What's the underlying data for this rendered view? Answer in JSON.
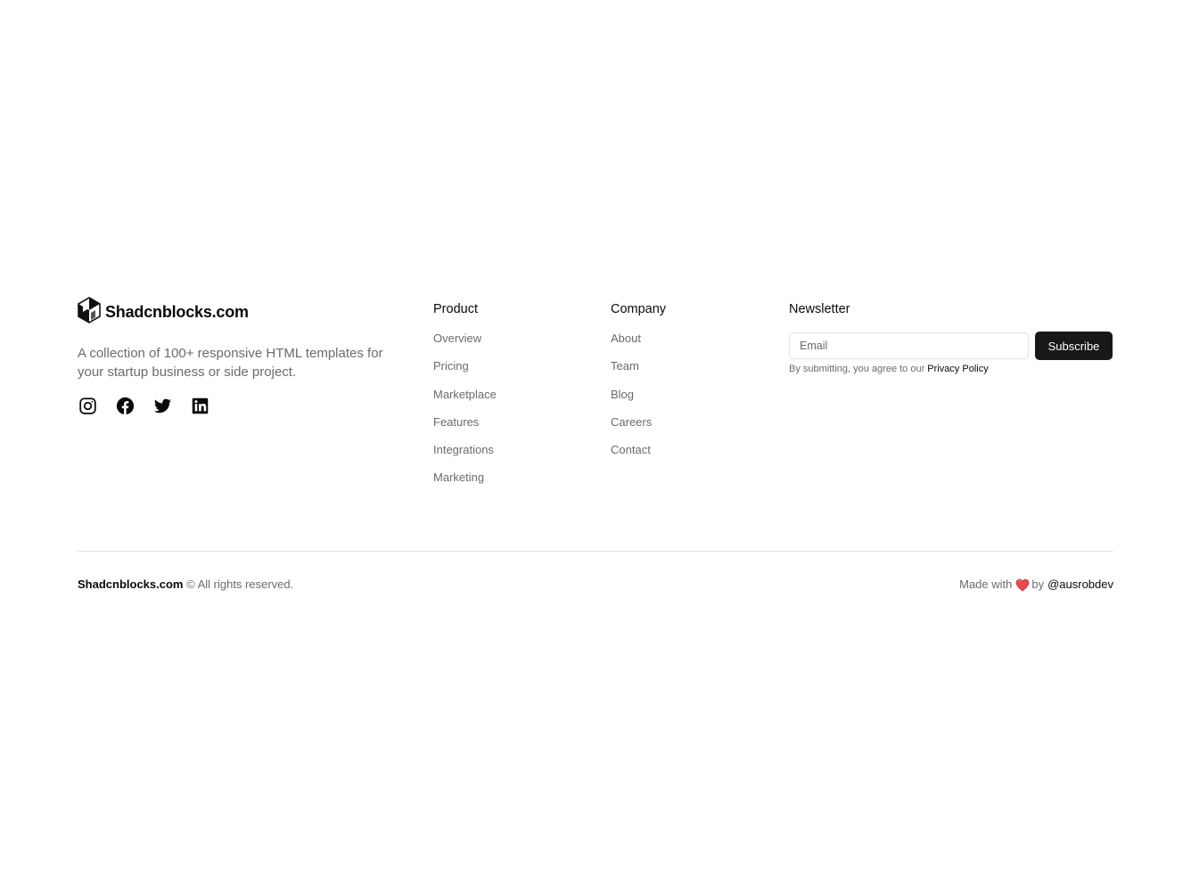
{
  "brand": {
    "name": "Shadcnblocks.com",
    "tagline": "A collection of 100+ responsive HTML templates for your startup business or side project.",
    "logo_icon": "hexagon-logo-icon"
  },
  "socials": [
    {
      "name": "instagram-icon"
    },
    {
      "name": "facebook-icon"
    },
    {
      "name": "twitter-icon"
    },
    {
      "name": "linkedin-icon"
    }
  ],
  "product": {
    "heading": "Product",
    "items": [
      "Overview",
      "Pricing",
      "Marketplace",
      "Features",
      "Integrations",
      "Marketing"
    ]
  },
  "company": {
    "heading": "Company",
    "items": [
      "About",
      "Team",
      "Blog",
      "Careers",
      "Contact"
    ]
  },
  "newsletter": {
    "heading": "Newsletter",
    "email_placeholder": "Email",
    "email_value": "",
    "subscribe_label": "Subscribe",
    "consent_text": "By submitting, you agree to our",
    "privacy_link": "Privacy Policy"
  },
  "bottom": {
    "site": "Shadcnblocks.com",
    "rights": "© All rights reserved.",
    "made_with": "Made with",
    "by": "by",
    "author": "@ausrobdev",
    "heart_color": "#e5484d"
  },
  "colors": {
    "text": "#0a0a0a",
    "muted": "#6b6b6b",
    "button_bg": "#18181b",
    "border": "#e4e4e7"
  }
}
